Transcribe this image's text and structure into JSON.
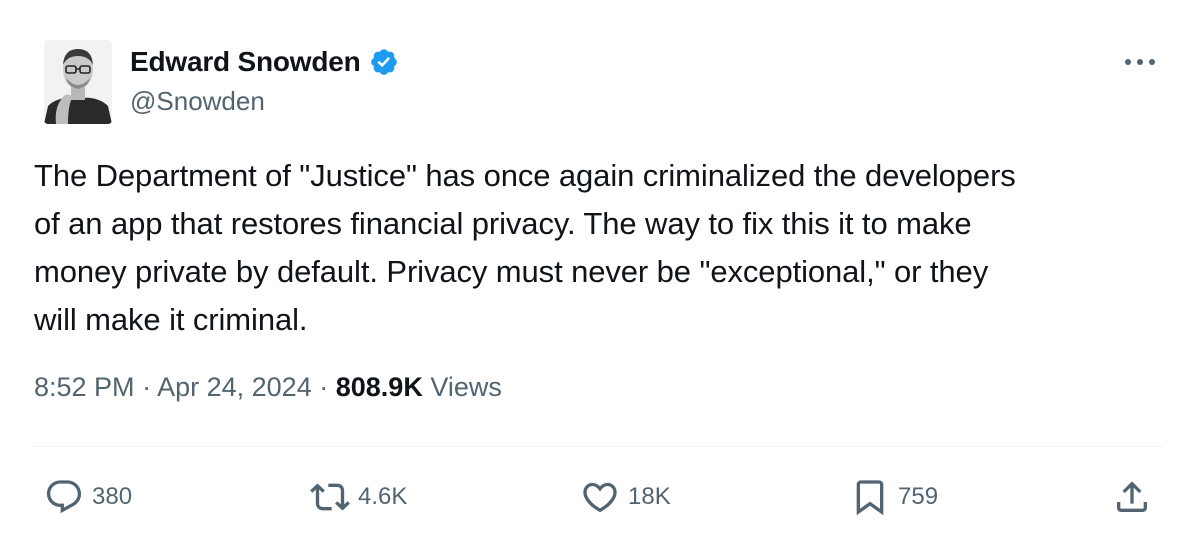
{
  "author": {
    "display_name": "Edward Snowden",
    "handle": "@Snowden",
    "verified": true,
    "verified_color": "#1d9bf0"
  },
  "tweet": {
    "text": "The Department of \"Justice\" has once again criminalized the developers\nof an app that restores financial privacy. The way to fix this it to make\nmoney private by default. Privacy must never be \"exceptional,\" or they\nwill make it criminal.",
    "time": "8:52 PM",
    "separator": "·",
    "date": "Apr 24, 2024",
    "views_count": "808.9K",
    "views_label": "Views"
  },
  "actions": {
    "replies": "380",
    "reposts": "4.6K",
    "likes": "18K",
    "bookmarks": "759"
  },
  "icons": {
    "more": "more-horizontal-icon",
    "reply": "reply-icon",
    "repost": "repost-icon",
    "like": "heart-icon",
    "bookmark": "bookmark-icon",
    "share": "share-icon"
  },
  "colors": {
    "text_primary": "#0f1419",
    "text_secondary": "#536471",
    "divider": "#eff3f4"
  }
}
